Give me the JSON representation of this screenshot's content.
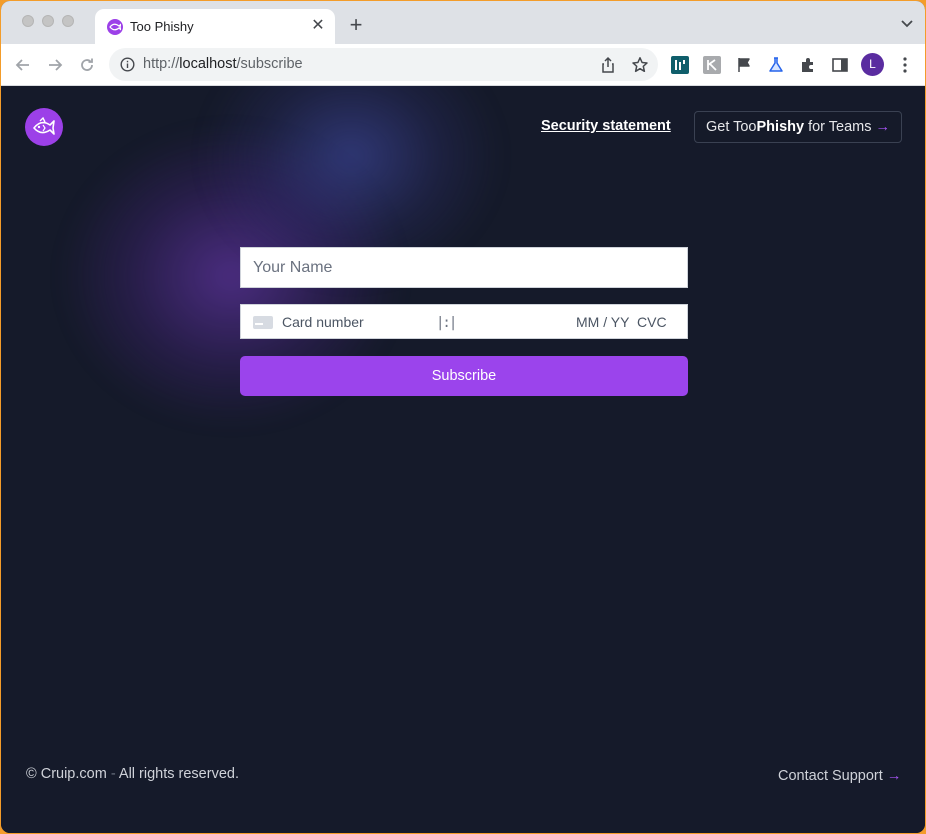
{
  "browser": {
    "tab_title": "Too Phishy",
    "tab_close": "✕",
    "new_tab": "+",
    "url_scheme": "http://",
    "url_host": "localhost",
    "url_path": "/subscribe",
    "avatar_letter": "L"
  },
  "header": {
    "security_link": "Security statement",
    "teams_prefix": "Get Too",
    "teams_brand": "Phishy",
    "teams_suffix": " for Teams ",
    "arrow": "→"
  },
  "form": {
    "name_placeholder": "Your Name",
    "card_number_placeholder": "Card number",
    "cursor_glyph": "|:|",
    "expiry_placeholder": "MM / YY",
    "cvc_placeholder": "CVC",
    "subscribe_label": "Subscribe"
  },
  "footer": {
    "copyright_symbol": "©",
    "company": " Cruip.com ",
    "separator": "-",
    "rights": " All rights reserved.",
    "contact_label": "Contact Support ",
    "arrow": "→"
  },
  "colors": {
    "accent": "#9b44ec",
    "background": "#151a2a",
    "arrow": "#a855f7"
  }
}
